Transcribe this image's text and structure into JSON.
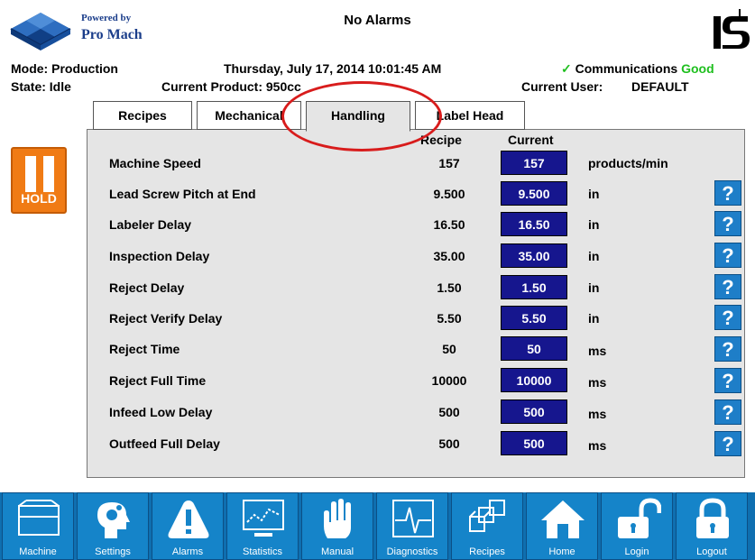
{
  "header": {
    "powered_by": "Powered by",
    "brand": "Pro Mach",
    "alarm_status": "No Alarms",
    "mode_label": "Mode: Production",
    "state_label": "State: Idle",
    "datetime": "Thursday, July 17, 2014 10:01:45 AM",
    "current_product": "Current Product: 950cc",
    "comm_label": "Communications",
    "comm_status": "Good",
    "current_user_label": "Current User:",
    "current_user": "DEFAULT"
  },
  "tabs": [
    {
      "label": "Recipes",
      "active": false
    },
    {
      "label": "Mechanical",
      "active": false
    },
    {
      "label": "Handling",
      "active": true
    },
    {
      "label": "Label Head",
      "active": false
    }
  ],
  "hold_button": {
    "label": "HOLD",
    "color": "#f07b15"
  },
  "columns": {
    "recipe": "Recipe",
    "current": "Current"
  },
  "rows": [
    {
      "label": "Machine Speed",
      "recipe": "157",
      "current": "157",
      "unit": "products/min",
      "help": false
    },
    {
      "label": "Lead Screw Pitch at End",
      "recipe": "9.500",
      "current": "9.500",
      "unit": "in",
      "help": true
    },
    {
      "label": "Labeler Delay",
      "recipe": "16.50",
      "current": "16.50",
      "unit": "in",
      "help": true
    },
    {
      "label": "Inspection Delay",
      "recipe": "35.00",
      "current": "35.00",
      "unit": "in",
      "help": true
    },
    {
      "label": "Reject Delay",
      "recipe": "1.50",
      "current": "1.50",
      "unit": "in",
      "help": true
    },
    {
      "label": "Reject Verify Delay",
      "recipe": "5.50",
      "current": "5.50",
      "unit": "in",
      "help": true
    },
    {
      "label": "Reject Time",
      "recipe": "50",
      "current": "50",
      "unit": "ms",
      "help": true
    },
    {
      "label": "Reject Full Time",
      "recipe": "10000",
      "current": "10000",
      "unit": "ms",
      "help": true
    },
    {
      "label": "Infeed Low Delay",
      "recipe": "500",
      "current": "500",
      "unit": "ms",
      "help": true
    },
    {
      "label": "Outfeed Full Delay",
      "recipe": "500",
      "current": "500",
      "unit": "ms",
      "help": true
    }
  ],
  "help_glyph": "?",
  "nav": [
    {
      "label": "Machine",
      "icon": "machine-icon"
    },
    {
      "label": "Settings",
      "icon": "settings-icon"
    },
    {
      "label": "Alarms",
      "icon": "alarms-icon"
    },
    {
      "label": "Statistics",
      "icon": "statistics-icon"
    },
    {
      "label": "Manual",
      "icon": "manual-icon"
    },
    {
      "label": "Diagnostics",
      "icon": "diagnostics-icon"
    },
    {
      "label": "Recipes",
      "icon": "recipes-icon"
    },
    {
      "label": "Home",
      "icon": "home-icon"
    },
    {
      "label": "Login",
      "icon": "login-icon"
    },
    {
      "label": "Logout",
      "icon": "logout-icon"
    }
  ],
  "colors": {
    "current_value_bg": "#16168e",
    "help_bg": "#1e7ec8",
    "nav_bg": "#1584c9",
    "comm_good": "#1fbf1f",
    "annotation_oval": "#d81c1c"
  }
}
